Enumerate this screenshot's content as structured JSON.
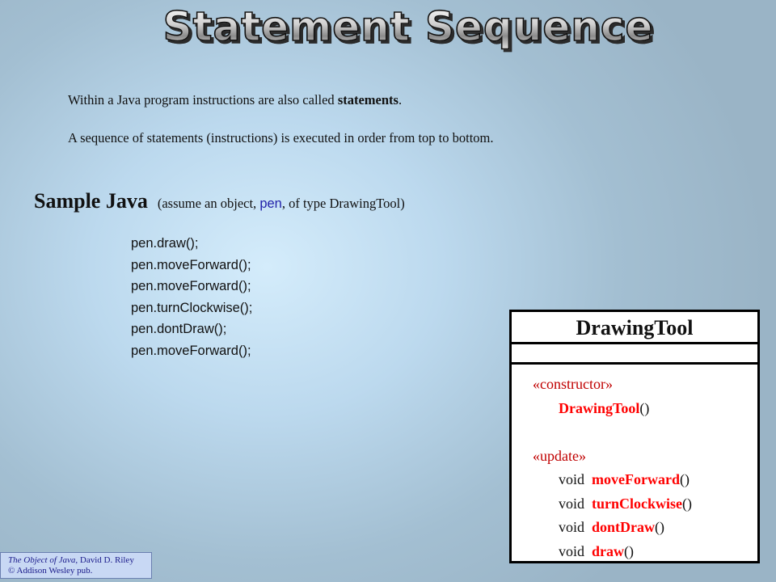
{
  "title": "Statement Sequence",
  "intro": {
    "line1_prefix": "Within a Java program instructions are also called ",
    "line1_bold": "statements",
    "line1_suffix": ".",
    "line2": "A sequence of statements (instructions) is executed in order from top to bottom."
  },
  "sample": {
    "heading": "Sample Java",
    "note_prefix": "(assume an object, ",
    "note_object": "pen",
    "note_suffix": ", of type DrawingTool)"
  },
  "code_lines": [
    "pen.draw();",
    "pen.moveForward();",
    "pen.moveForward();",
    "pen.turnClockwise();",
    "pen.dontDraw();",
    "pen.moveForward();"
  ],
  "uml": {
    "class_name": "DrawingTool",
    "constructor_stereotype": "«constructor»",
    "constructor_name": "DrawingTool",
    "constructor_parens": "()",
    "update_stereotype": "«update»",
    "methods": [
      {
        "return_type": "void",
        "name": "moveForward",
        "parens": "()"
      },
      {
        "return_type": "void",
        "name": "turnClockwise",
        "parens": "()"
      },
      {
        "return_type": "void",
        "name": "dontDraw",
        "parens": "()"
      },
      {
        "return_type": "void",
        "name": "draw",
        "parens": "()"
      }
    ]
  },
  "credit": {
    "book": "The Object of Java",
    "author": ", David D. Riley",
    "publisher": "© Addison Wesley pub."
  }
}
